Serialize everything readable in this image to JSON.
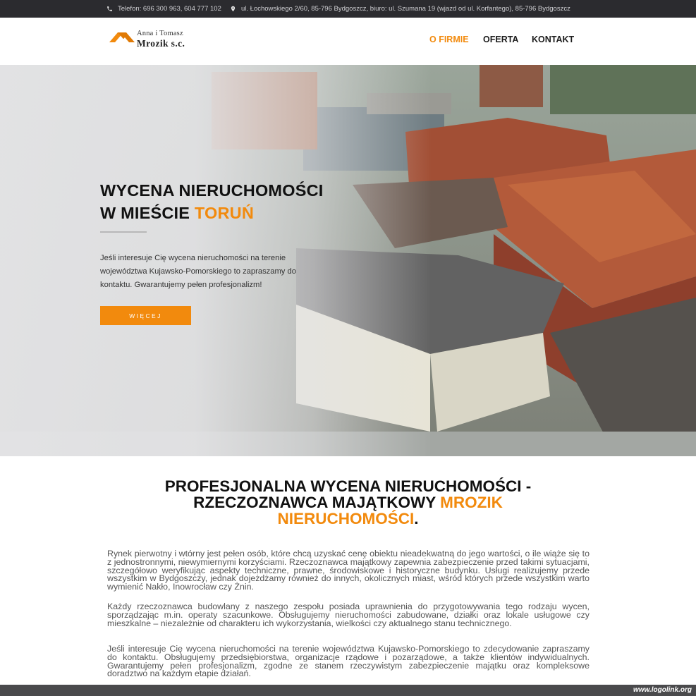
{
  "topbar": {
    "phone": "Telefon: 696 300 963, 604 777 102",
    "address": "ul. Łochowskiego 2/60, 85-796 Bydgoszcz, biuro: ul. Szumana 19 (wjazd od ul. Korfantego), 85-796 Bydgoszcz"
  },
  "logo": {
    "line1": "Anna i Tomasz",
    "line2": "Mrozik s.c."
  },
  "nav": {
    "items": [
      "O FIRMIE",
      "OFERTA",
      "KONTAKT"
    ],
    "active": "O FIRMIE"
  },
  "hero": {
    "title_line1": "WYCENA NIERUCHOMOŚCI",
    "title_line2_prefix": "W MIEŚCIE ",
    "title_line2_accent": "TORUŃ",
    "text": "Jeśli interesuje Cię wycena nieruchomości na terenie województwa Kujawsko-Pomorskiego to zapraszamy do kontaktu. Gwarantujemy pełen profesjonalizm!",
    "button": "WIĘCEJ"
  },
  "section": {
    "title_line1": "PROFESJONALNA WYCENA NIERUCHOMOŚCI -",
    "title_line2_prefix": "RZECZOZNAWCA MAJĄTKOWY ",
    "title_line2_accent": "MROZIK",
    "title_line3_accent": "NIERUCHOMOŚCI",
    "title_line3_suffix": ".",
    "paragraphs": [
      "Rynek pierwotny i wtórny jest pełen osób, które chcą uzyskać cenę obiektu nieadekwatną do jego wartości, o ile wiąże się to z jednostronnymi, niewymiernymi korzyściami. Rzeczoznawca majątkowy zapewnia zabezpieczenie przed takimi sytuacjami, szczegółowo weryfikując aspekty techniczne, prawne, środowiskowe i historyczne budynku. Usługi realizujemy przede wszystkim w Bydgoszczy, jednak dojeżdżamy również do innych, okolicznych miast, wśród których przede wszystkim warto wymienić Nakło, Inowrocław czy Żnin.",
      "Każdy rzeczoznawca budowlany z naszego zespołu posiada uprawnienia do przygotowywania tego rodzaju wycen, sporządzając m.in. operaty szacunkowe. Obsługujemy nieruchomości zabudowane, działki oraz lokale usługowe czy mieszkalne – niezależnie od charakteru ich wykorzystania, wielkości czy aktualnego stanu technicznego.",
      "Jeśli interesuje Cię wycena nieruchomości na terenie województwa Kujawsko-Pomorskiego to zdecydowanie zapraszamy do kontaktu. Obsługujemy przedsiębiorstwa, organizacje rządowe i pozarządowe, a także klientów indywidualnych. Gwarantujemy pełen profesjonalizm, zgodne ze stanem rzeczywistym zabezpieczenie majątku oraz kompleksowe doradztwo na każdym etapie działań."
    ]
  },
  "watermark": "www.logolink.org",
  "colors": {
    "accent": "#f28a0d",
    "topbar": "#2b2b2f"
  }
}
